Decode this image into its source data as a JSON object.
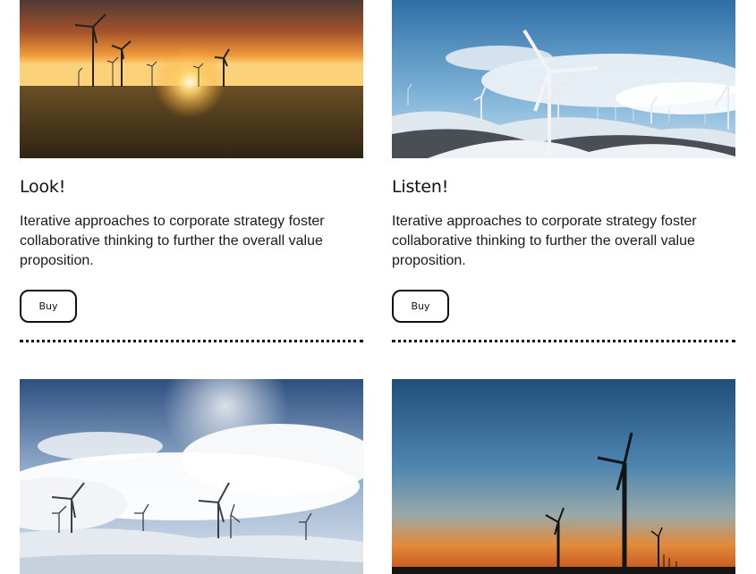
{
  "cards": [
    {
      "title": "Look!",
      "description": "Iterative approaches to corporate strategy foster collaborative thinking to further the overall value proposition.",
      "button_label": "Buy",
      "image": "wind-turbines-sunset-field-photo"
    },
    {
      "title": "Listen!",
      "description": "Iterative approaches to corporate strategy foster collaborative thinking to further the overall value proposition.",
      "button_label": "Buy",
      "image": "wind-turbines-snowy-hills-photo"
    },
    {
      "image": "wind-turbines-cloudy-snow-photo"
    },
    {
      "image": "wind-turbines-dusk-silhouette-photo"
    }
  ],
  "colors": {
    "sunset_sky_top": "#5a3a2e",
    "sunset_glow": "#f7a23b",
    "field": "#5b4a2a",
    "sky_blue": "#3f7fb3",
    "snow": "#e9eef3",
    "dusk_top": "#2a5f8f",
    "dusk_bottom": "#e8742a"
  }
}
